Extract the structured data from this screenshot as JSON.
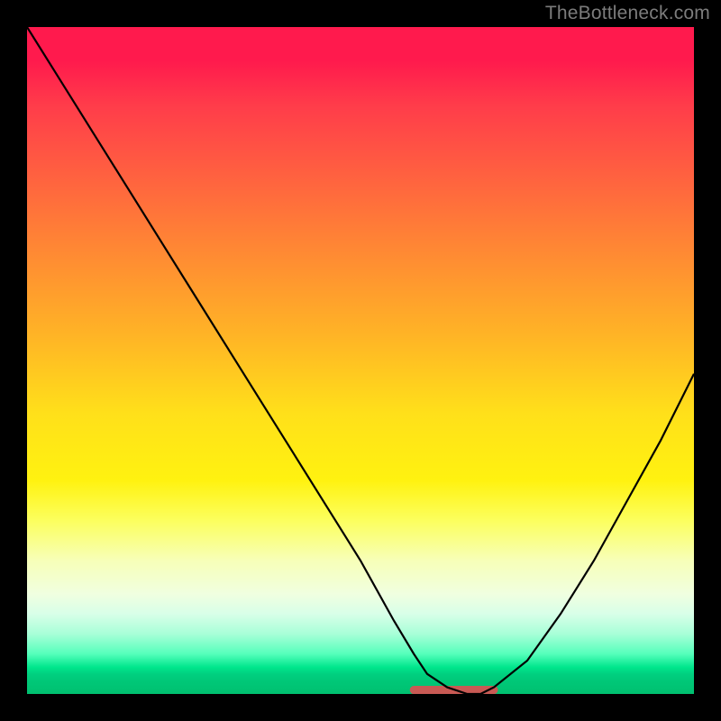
{
  "watermark": "TheBottleneck.com",
  "chart_data": {
    "type": "line",
    "title": "",
    "xlabel": "",
    "ylabel": "",
    "xlim": [
      0,
      100
    ],
    "ylim": [
      0,
      100
    ],
    "grid": false,
    "legend": false,
    "series": [
      {
        "name": "bottleneck-curve",
        "x": [
          0,
          5,
          10,
          15,
          20,
          25,
          30,
          35,
          40,
          45,
          50,
          55,
          58,
          60,
          63,
          66,
          68,
          70,
          75,
          80,
          85,
          90,
          95,
          100
        ],
        "values": [
          100,
          92,
          84,
          76,
          68,
          60,
          52,
          44,
          36,
          28,
          20,
          11,
          6,
          3,
          1,
          0,
          0,
          1,
          5,
          12,
          20,
          29,
          38,
          48
        ]
      },
      {
        "name": "optimal-range-band",
        "x": [
          58,
          70
        ],
        "values": [
          0.6,
          0.6
        ]
      }
    ],
    "background_gradient": {
      "orientation": "vertical",
      "stops": [
        {
          "pos": 0.0,
          "color": "#ff1a4d"
        },
        {
          "pos": 0.5,
          "color": "#ffcc20"
        },
        {
          "pos": 0.75,
          "color": "#fcff5e"
        },
        {
          "pos": 0.95,
          "color": "#00e68c"
        },
        {
          "pos": 1.0,
          "color": "#00c070"
        }
      ]
    }
  }
}
